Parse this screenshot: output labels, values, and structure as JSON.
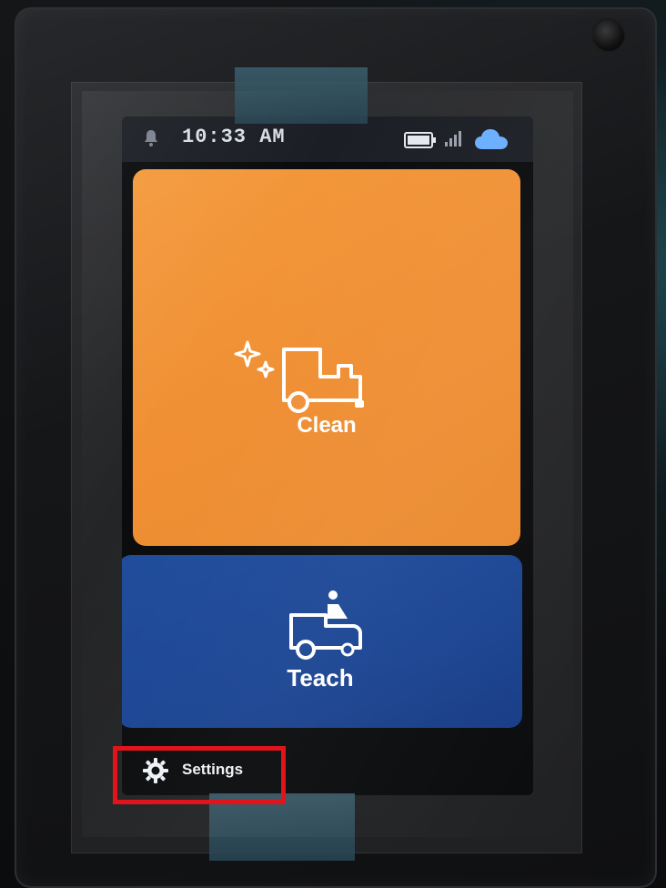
{
  "status_bar": {
    "time": "10:33 AM",
    "icons": [
      "bell-icon",
      "battery-icon",
      "signal-icon",
      "cloud-icon"
    ]
  },
  "tiles": [
    {
      "label": "Clean",
      "icon": "sparkle-cleaning-vehicle-icon",
      "color": "#f0913a"
    },
    {
      "label": "Teach",
      "icon": "vehicle-with-operator-icon",
      "color": "#1c4794"
    }
  ],
  "settings": {
    "label": "Settings",
    "icon": "gear-icon"
  },
  "highlight": {
    "color": "#e1141b",
    "target": "settings"
  },
  "colors": {
    "status_bar_bg": "#1b1e24",
    "status_text": "#d9dde6",
    "accent_cloud": "#5aa7ff"
  }
}
